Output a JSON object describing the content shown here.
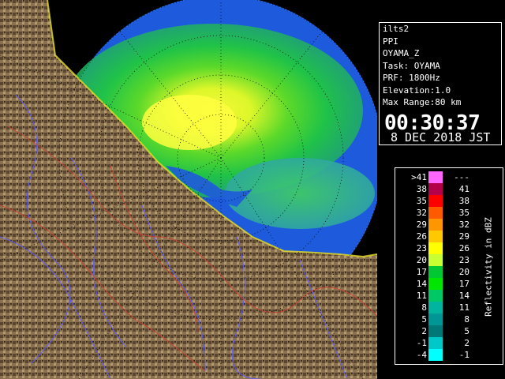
{
  "info": {
    "name": "ilts2",
    "product": "PPI",
    "field": "OYAMA_Z",
    "task": "Task: OYAMA",
    "prf": "PRF: 1800Hz",
    "elevation": "Elevation:1.0",
    "max_range": "Max Range:80 km",
    "time": "00:30:37",
    "date": "8 DEC 2018 JST"
  },
  "legend": {
    "unit": "Reflectivity in dBZ",
    "rows": [
      {
        "lo": ">41",
        "hi": "---",
        "color": "#ff66ff"
      },
      {
        "lo": "38",
        "hi": "41",
        "color": "#b4004b"
      },
      {
        "lo": "35",
        "hi": "38",
        "color": "#ff0000"
      },
      {
        "lo": "32",
        "hi": "35",
        "color": "#ff5a00"
      },
      {
        "lo": "29",
        "hi": "32",
        "color": "#ff9600"
      },
      {
        "lo": "26",
        "hi": "29",
        "color": "#ffc800"
      },
      {
        "lo": "23",
        "hi": "26",
        "color": "#ffff00"
      },
      {
        "lo": "20",
        "hi": "23",
        "color": "#c8ff32"
      },
      {
        "lo": "17",
        "hi": "20",
        "color": "#00c832"
      },
      {
        "lo": "14",
        "hi": "17",
        "color": "#00e600"
      },
      {
        "lo": "11",
        "hi": "14",
        "color": "#00c864"
      },
      {
        "lo": "8",
        "hi": "11",
        "color": "#00b4a0"
      },
      {
        "lo": "5",
        "hi": "8",
        "color": "#009696"
      },
      {
        "lo": "2",
        "hi": "5",
        "color": "#007878"
      },
      {
        "lo": "-1",
        "hi": "2",
        "color": "#00c8c8"
      },
      {
        "lo": "-4",
        "hi": "-1",
        "color": "#00ffff"
      }
    ]
  },
  "colors": {
    "sea_background": "#1e5adc",
    "land": "#8a7250",
    "rivers": "#5050ff",
    "borders": "#c83c28"
  }
}
